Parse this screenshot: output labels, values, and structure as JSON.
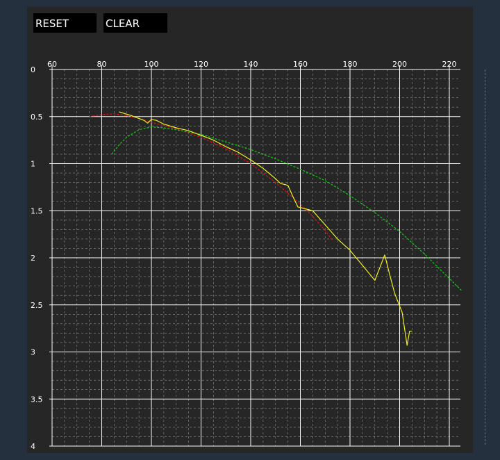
{
  "controls": {
    "reset_label": "RESET",
    "clear_label": "CLEAR"
  },
  "colors": {
    "background": "#25303f",
    "panel": "#262626",
    "grid_major": "#ffffff",
    "grid_minor": "#bbbbbb"
  },
  "chart_data": {
    "type": "line",
    "title": "",
    "xlabel": "",
    "ylabel": "",
    "x_axis_position": "top",
    "y_inverted": true,
    "xlim": [
      60,
      225
    ],
    "ylim": [
      0,
      4
    ],
    "x_ticks": [
      "60",
      "80",
      "100",
      "120",
      "140",
      "160",
      "180",
      "200",
      "220"
    ],
    "y_ticks": [
      "0",
      "0.5",
      "1",
      "1.5",
      "2",
      "2.5",
      "3",
      "3.5",
      "4"
    ],
    "grid": true,
    "series": [
      {
        "color": "#e01010",
        "style": "dashed",
        "points": [
          [
            75,
            0.5
          ],
          [
            80,
            0.48
          ],
          [
            85,
            0.47
          ],
          [
            90,
            0.49
          ],
          [
            95,
            0.52
          ],
          [
            100,
            0.56
          ],
          [
            110,
            0.63
          ],
          [
            120,
            0.72
          ],
          [
            130,
            0.84
          ],
          [
            140,
            1.0
          ],
          [
            150,
            1.2
          ],
          [
            160,
            1.43
          ],
          [
            165,
            1.56
          ],
          [
            170,
            1.71
          ],
          [
            173,
            1.82
          ]
        ]
      },
      {
        "color": "#10d010",
        "style": "dashed",
        "points": [
          [
            84,
            0.9
          ],
          [
            87,
            0.8
          ],
          [
            90,
            0.72
          ],
          [
            95,
            0.64
          ],
          [
            100,
            0.61
          ],
          [
            105,
            0.62
          ],
          [
            110,
            0.64
          ],
          [
            120,
            0.69
          ],
          [
            130,
            0.77
          ],
          [
            140,
            0.85
          ],
          [
            150,
            0.95
          ],
          [
            160,
            1.06
          ],
          [
            170,
            1.18
          ],
          [
            180,
            1.34
          ],
          [
            190,
            1.52
          ],
          [
            200,
            1.72
          ],
          [
            210,
            1.96
          ],
          [
            220,
            2.22
          ],
          [
            225,
            2.35
          ]
        ]
      },
      {
        "color": "#f0f020",
        "style": "solid",
        "points": [
          [
            87,
            0.45
          ],
          [
            92,
            0.49
          ],
          [
            97,
            0.54
          ],
          [
            98.5,
            0.57
          ],
          [
            100,
            0.53
          ],
          [
            102,
            0.54
          ],
          [
            105,
            0.58
          ],
          [
            110,
            0.62
          ],
          [
            115,
            0.65
          ],
          [
            120,
            0.7
          ],
          [
            125,
            0.75
          ],
          [
            130,
            0.82
          ],
          [
            135,
            0.88
          ],
          [
            140,
            0.96
          ],
          [
            145,
            1.05
          ],
          [
            150,
            1.16
          ],
          [
            152,
            1.21
          ],
          [
            155,
            1.23
          ],
          [
            157,
            1.35
          ],
          [
            159,
            1.46
          ],
          [
            162,
            1.48
          ],
          [
            165,
            1.5
          ],
          [
            170,
            1.65
          ],
          [
            175,
            1.8
          ],
          [
            180,
            1.92
          ],
          [
            185,
            2.08
          ],
          [
            190,
            2.24
          ],
          [
            194,
            1.97
          ],
          [
            196,
            2.18
          ],
          [
            198,
            2.38
          ],
          [
            201,
            2.58
          ],
          [
            203,
            2.93
          ],
          [
            204,
            2.78
          ],
          [
            205,
            2.78
          ]
        ]
      }
    ]
  }
}
